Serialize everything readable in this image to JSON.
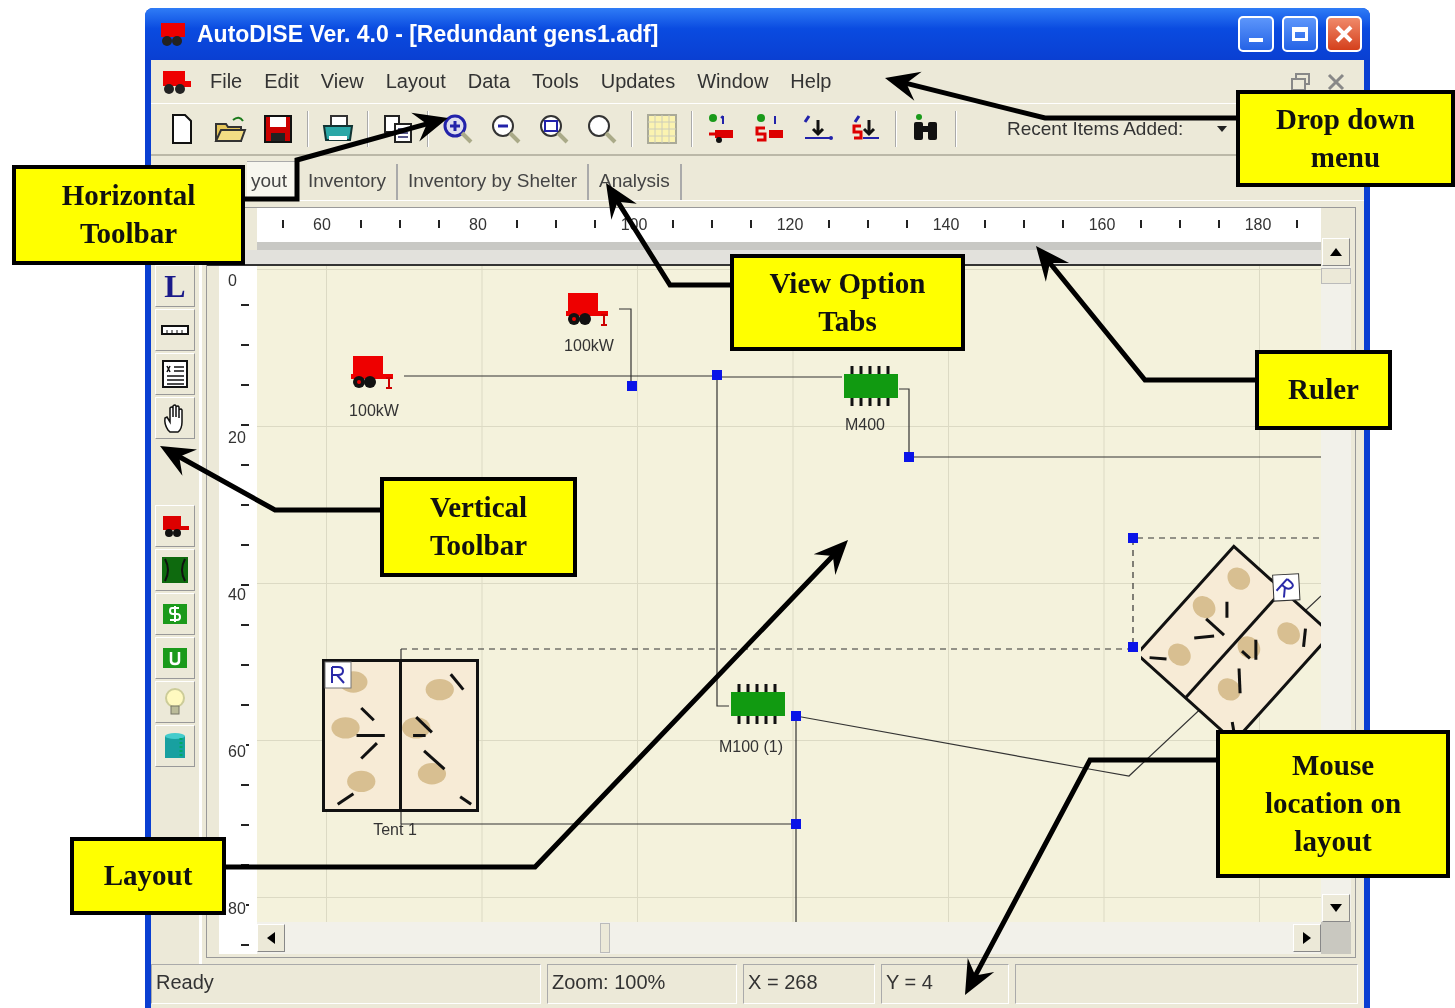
{
  "window": {
    "title": "AutoDISE Ver. 4.0 - [Redundant gens1.adf]"
  },
  "menu": [
    {
      "label": "File"
    },
    {
      "label": "Edit"
    },
    {
      "label": "View"
    },
    {
      "label": "Layout"
    },
    {
      "label": "Data"
    },
    {
      "label": "Tools"
    },
    {
      "label": "Updates"
    },
    {
      "label": "Window"
    },
    {
      "label": "Help"
    }
  ],
  "toolbar": {
    "recent_label": "Recent Items Added:"
  },
  "tabs": [
    {
      "label": "yout",
      "selected": true
    },
    {
      "label": "Inventory",
      "selected": false
    },
    {
      "label": "Inventory by Shelter",
      "selected": false
    },
    {
      "label": "Analysis",
      "selected": false
    }
  ],
  "ruler": {
    "horizontal": [
      "60",
      "80",
      "100",
      "120",
      "140",
      "160",
      "180"
    ],
    "vertical": [
      "0",
      "20",
      "40",
      "60",
      "80"
    ]
  },
  "vertical_toolbar": {
    "letter_tool": "L"
  },
  "layout": {
    "items": [
      {
        "kind": "generator",
        "label": "100kW"
      },
      {
        "kind": "generator",
        "label": "100kW"
      },
      {
        "kind": "module",
        "label": "M400"
      },
      {
        "kind": "module",
        "label": "M100 (1)"
      },
      {
        "kind": "tent",
        "label": "Tent 1"
      },
      {
        "kind": "tent_rotated"
      }
    ]
  },
  "status_bar": {
    "message": "Ready",
    "zoom": "Zoom: 100%",
    "x": "X = 268",
    "y": "Y = 4"
  },
  "callouts": [
    {
      "text": "Drop down menu"
    },
    {
      "text": "Horizontal Toolbar"
    },
    {
      "text": "View Option Tabs"
    },
    {
      "text": "Ruler"
    },
    {
      "text": "Vertical Toolbar"
    },
    {
      "text": "Mouse location on layout"
    },
    {
      "text": "Layout"
    }
  ]
}
